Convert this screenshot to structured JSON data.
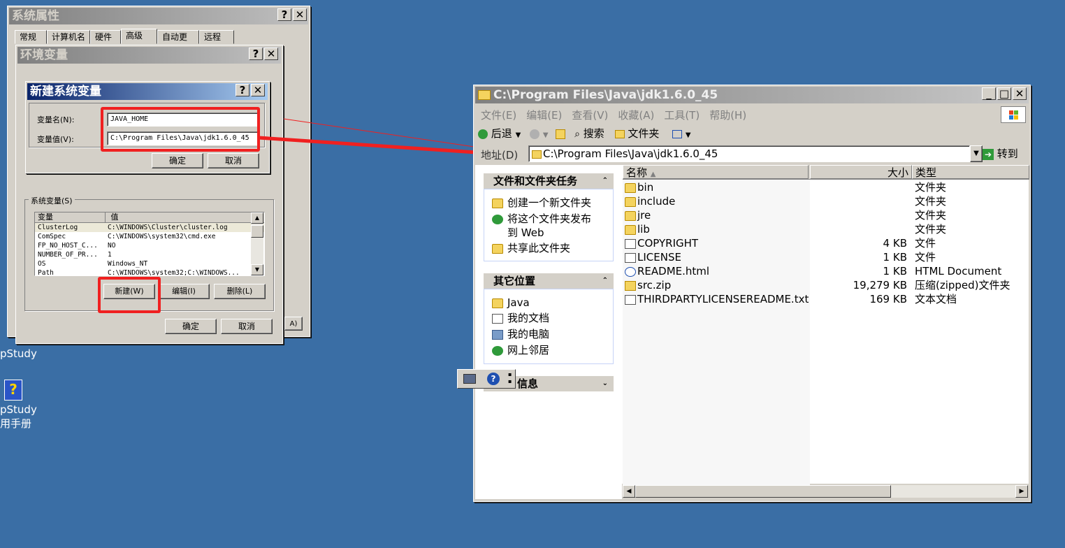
{
  "desktop": {
    "labels": [
      "pStudy",
      "pStudy",
      "用手册"
    ]
  },
  "sys_props": {
    "title": "系统属性",
    "help_btn": "?",
    "close_btn": "✕",
    "tabs": [
      "常规",
      "计算机名",
      "硬件",
      "高级",
      "自动更新",
      "远程"
    ],
    "edge_text": "A)"
  },
  "env_vars": {
    "title": "环境变量",
    "help_btn": "?",
    "close_btn": "✕",
    "sys_group_label": "系统变量(S)",
    "columns": [
      "变量",
      "值"
    ],
    "rows": [
      [
        "ClusterLog",
        "C:\\WINDOWS\\Cluster\\cluster.log"
      ],
      [
        "ComSpec",
        "C:\\WINDOWS\\system32\\cmd.exe"
      ],
      [
        "FP_NO_HOST_C...",
        "NO"
      ],
      [
        "NUMBER_OF_PR...",
        "1"
      ],
      [
        "OS",
        "Windows_NT"
      ],
      [
        "Path",
        "C:\\WINDOWS\\system32;C:\\WINDOWS..."
      ]
    ],
    "new_btn": "新建(W)",
    "edit_btn": "编辑(I)",
    "delete_btn": "删除(L)",
    "ok_btn": "确定",
    "cancel_btn": "取消"
  },
  "new_var": {
    "title": "新建系统变量",
    "help_btn": "?",
    "close_btn": "✕",
    "name_label": "变量名(N):",
    "name_value": "JAVA_HOME",
    "value_label": "变量值(V):",
    "value_value": "C:\\Program Files\\Java\\jdk1.6.0_45",
    "ok_btn": "确定",
    "cancel_btn": "取消"
  },
  "explorer": {
    "title": "C:\\Program Files\\Java\\jdk1.6.0_45",
    "min_btn": "_",
    "max_btn": "□",
    "close_btn": "✕",
    "menu": [
      "文件(E)",
      "编辑(E)",
      "查看(V)",
      "收藏(A)",
      "工具(T)",
      "帮助(H)"
    ],
    "toolbar": {
      "back": "后退",
      "search": "搜索",
      "folders": "文件夹"
    },
    "address_label": "地址(D)",
    "address_value": "C:\\Program Files\\Java\\jdk1.6.0_45",
    "go_btn": "转到",
    "task_panel": {
      "title": "文件和文件夹任务",
      "items": [
        "创建一个新文件夹",
        "将这个文件夹发布",
        "到 Web",
        "共享此文件夹"
      ]
    },
    "places_panel": {
      "title": "其它位置",
      "items": [
        "Java",
        "我的文档",
        "我的电脑",
        "网上邻居"
      ]
    },
    "details_panel": {
      "title": "信息"
    },
    "columns": {
      "name": "名称",
      "size": "大小",
      "type": "类型"
    },
    "files": [
      {
        "name": "bin",
        "size": "",
        "type": "文件夹",
        "icon": "folder-icon"
      },
      {
        "name": "include",
        "size": "",
        "type": "文件夹",
        "icon": "folder-icon"
      },
      {
        "name": "jre",
        "size": "",
        "type": "文件夹",
        "icon": "folder-icon"
      },
      {
        "name": "lib",
        "size": "",
        "type": "文件夹",
        "icon": "folder-icon"
      },
      {
        "name": "COPYRIGHT",
        "size": "4 KB",
        "type": "文件",
        "icon": "document-icon"
      },
      {
        "name": "LICENSE",
        "size": "1 KB",
        "type": "文件",
        "icon": "document-icon"
      },
      {
        "name": "README.html",
        "size": "1 KB",
        "type": "HTML Document",
        "icon": "html-icon"
      },
      {
        "name": "src.zip",
        "size": "19,279 KB",
        "type": "压缩(zipped)文件夹",
        "icon": "zip-folder-icon"
      },
      {
        "name": "THIRDPARTYLICENSEREADME.txt",
        "size": "169 KB",
        "type": "文本文档",
        "icon": "text-file-icon"
      }
    ]
  },
  "colors": {
    "desktop": "#3a6ea5",
    "highlight_box": "#f02020",
    "title_active": "#0a246a"
  }
}
